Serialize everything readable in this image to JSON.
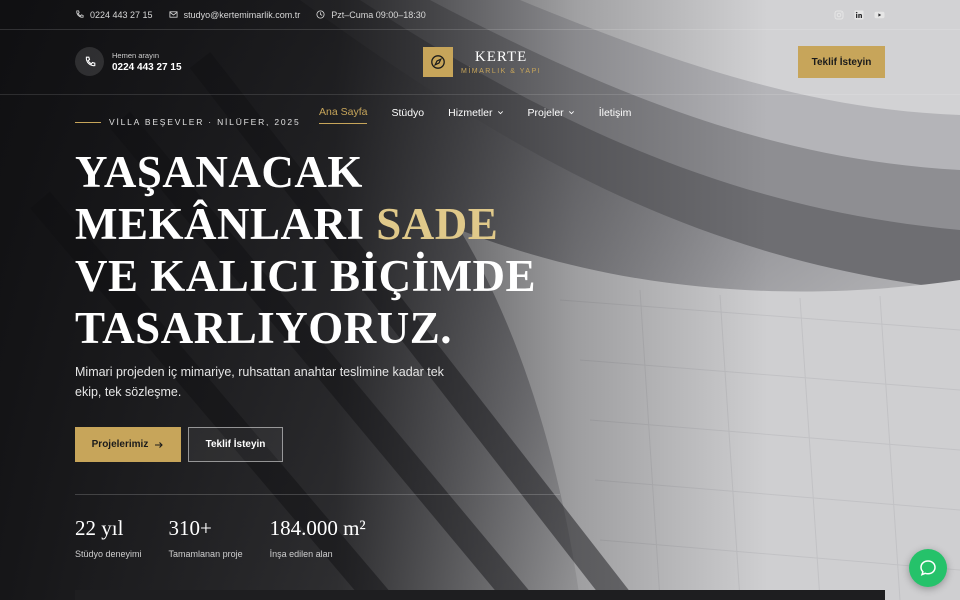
{
  "topbar": {
    "phone": "0224 443 27 15",
    "email": "studyo@kertemimarlik.com.tr",
    "hours": "Pzt–Cuma 09:00–18:30",
    "social": [
      "instagram-icon",
      "linkedin-icon",
      "youtube-icon"
    ]
  },
  "header": {
    "call_label": "Hemen arayın",
    "call_number": "0224 443 27 15",
    "logo_name": "KERTE",
    "logo_sub": "MİMARLIK & YAPI",
    "cta": "Teklif İsteyin"
  },
  "nav": {
    "items": [
      {
        "label": "Ana Sayfa",
        "active": true
      },
      {
        "label": "Stüdyo"
      },
      {
        "label": "Hizmetler",
        "dropdown": true
      },
      {
        "label": "Projeler",
        "dropdown": true
      },
      {
        "label": "İletişim"
      }
    ]
  },
  "hero": {
    "eyebrow": "VİLLA BEŞEVLER · NİLÜFER, 2025",
    "headline_1": "YAŞANACAK",
    "headline_2a": "MEKÂNLARI",
    "headline_2b": "SADE",
    "headline_3": "VE KALICI BİÇİMDE",
    "headline_4": "TASARLIYORUZ.",
    "lead": "Mimari projeden iç mimariye, ruhsattan anahtar teslimine kadar tek ekip, tek sözleşme.",
    "btn_primary": "Projelerimiz",
    "btn_secondary": "Teklif İsteyin"
  },
  "stats": [
    {
      "value": "22 yıl",
      "label": "Stüdyo deneyimi"
    },
    {
      "value": "310+",
      "label": "Tamamlanan proje"
    },
    {
      "value": "184.000 m²",
      "label": "İnşa edilen alan"
    }
  ],
  "colors": {
    "accent": "#c7a55a",
    "highlight": "#e0c98a",
    "chat": "#25c26a"
  }
}
